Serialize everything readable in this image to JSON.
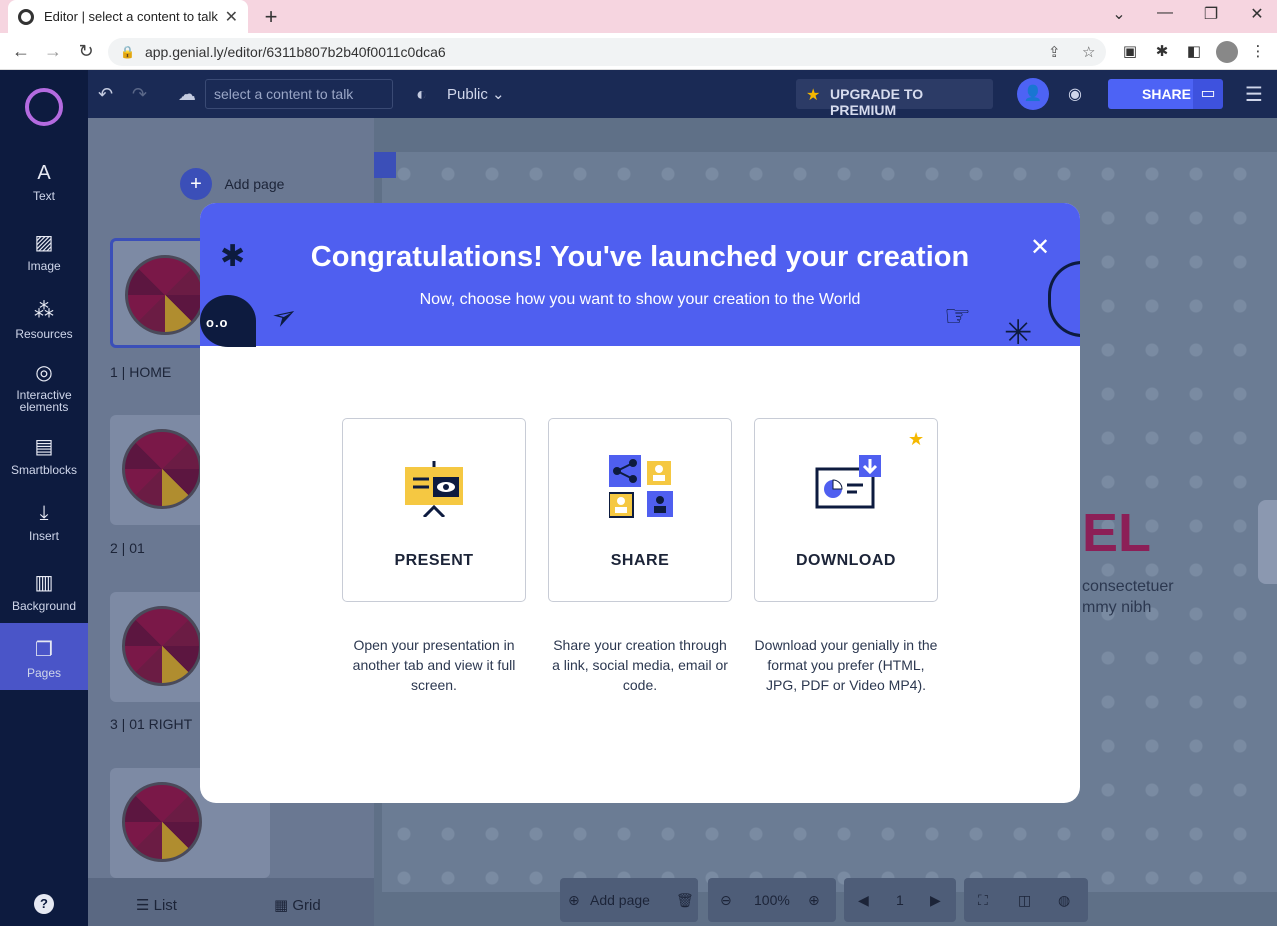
{
  "browser": {
    "tab_title": "Editor | select a content to talk",
    "url": "app.genial.ly/editor/6311b807b2b40f0011c0dca6"
  },
  "sidebar": {
    "items": [
      {
        "label": "Text",
        "icon": "text-icon"
      },
      {
        "label": "Image",
        "icon": "image-icon"
      },
      {
        "label": "Resources",
        "icon": "resources-icon"
      },
      {
        "label": "Interactive elements",
        "icon": "interactive-icon"
      },
      {
        "label": "Smartblocks",
        "icon": "smartblocks-icon"
      },
      {
        "label": "Insert",
        "icon": "insert-icon"
      },
      {
        "label": "Background",
        "icon": "background-icon"
      },
      {
        "label": "Pages",
        "icon": "pages-icon"
      }
    ],
    "help": "?"
  },
  "toolbar": {
    "talk_placeholder": "select a content to talk",
    "visibility": "Public",
    "upgrade": "UPGRADE TO PREMIUM",
    "share": "SHARE"
  },
  "pages_panel": {
    "add_page": "Add page",
    "pages": [
      {
        "label": "1 |  HOME"
      },
      {
        "label": "2 |  01"
      },
      {
        "label": "3 |  01 RIGHT"
      }
    ],
    "list": "List",
    "grid": "Grid"
  },
  "canvas": {
    "title_fragment": "EL",
    "text_line1": "consectetuer",
    "text_line2": "mmy nibh"
  },
  "bottom": {
    "add_page": "Add page",
    "zoom": "100%",
    "page": "1"
  },
  "modal": {
    "title": "Congratulations! You've launched your creation",
    "subtitle": "Now, choose how you want to show your creation to the World",
    "options": [
      {
        "label": "PRESENT",
        "desc": "Open your presentation in another tab and view it full screen."
      },
      {
        "label": "SHARE",
        "desc": "Share your creation through a link, social media, email or code."
      },
      {
        "label": "DOWNLOAD",
        "desc": "Download your genially in the format you prefer (HTML, JPG, PDF or Video MP4)."
      }
    ],
    "decor_eyes": "o.o"
  },
  "colors": {
    "modal_header": "#4f5ff0",
    "dark_navy": "#0d1b3f",
    "premium_star": "#f5b800",
    "accent_blue": "#4d63f5"
  }
}
